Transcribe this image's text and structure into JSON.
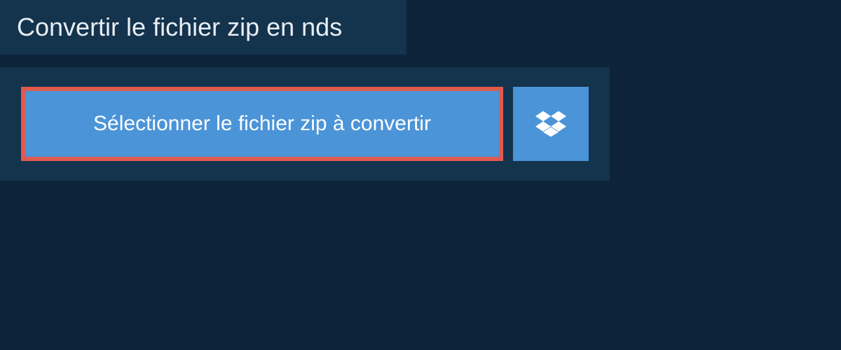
{
  "header": {
    "title": "Convertir le fichier zip en nds"
  },
  "actions": {
    "select_file_label": "Sélectionner le fichier zip à convertir"
  }
}
